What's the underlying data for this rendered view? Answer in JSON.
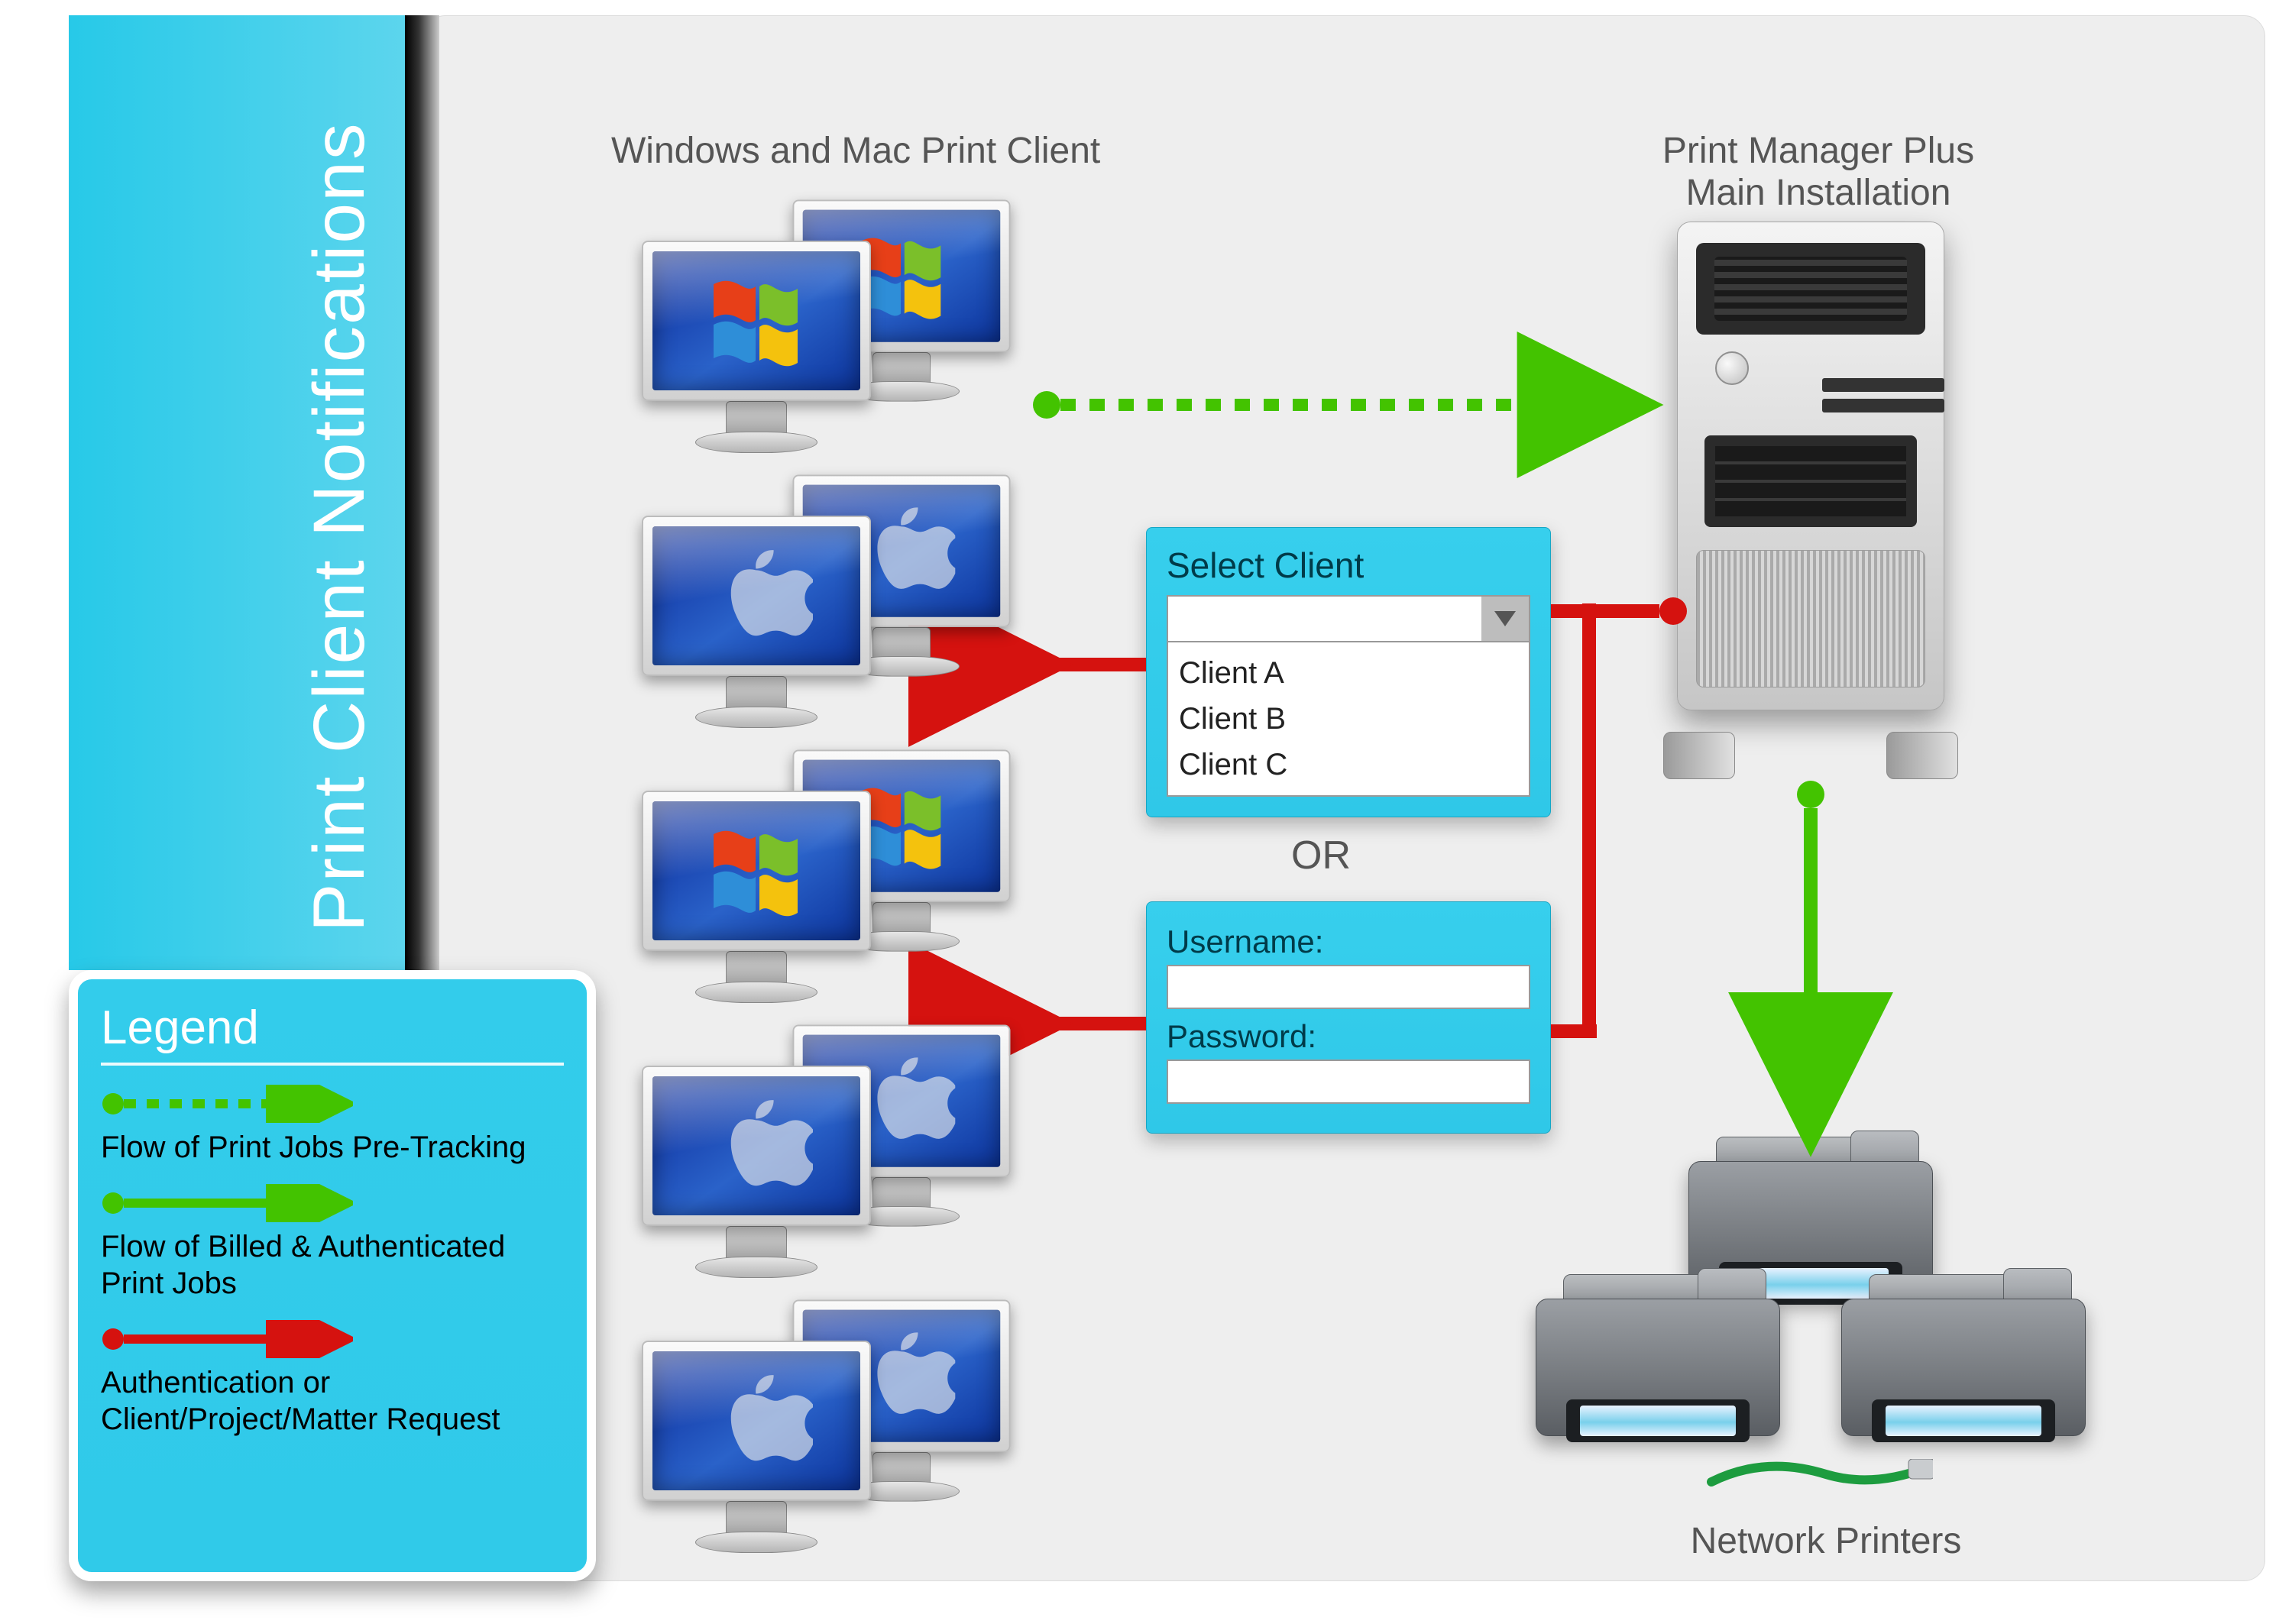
{
  "title": "Print Client Notifications",
  "labels": {
    "workstations": "Windows and Mac Print Client",
    "server_line1": "Print Manager Plus",
    "server_line2": "Main Installation",
    "printers": "Network Printers",
    "or": "OR"
  },
  "select": {
    "heading": "Select Client",
    "options": [
      "Client A",
      "Client B",
      "Client C"
    ]
  },
  "login": {
    "username_label": "Username:",
    "password_label": "Password:"
  },
  "legend": {
    "title": "Legend",
    "item1": "Flow of Print Jobs Pre-Tracking",
    "item2": "Flow of Billed & Authenticated Print Jobs",
    "item3": "Authentication or Client/Project/Matter Request"
  },
  "colors": {
    "green": "#43c300",
    "red": "#d5120f",
    "cyan": "#33cceb"
  }
}
